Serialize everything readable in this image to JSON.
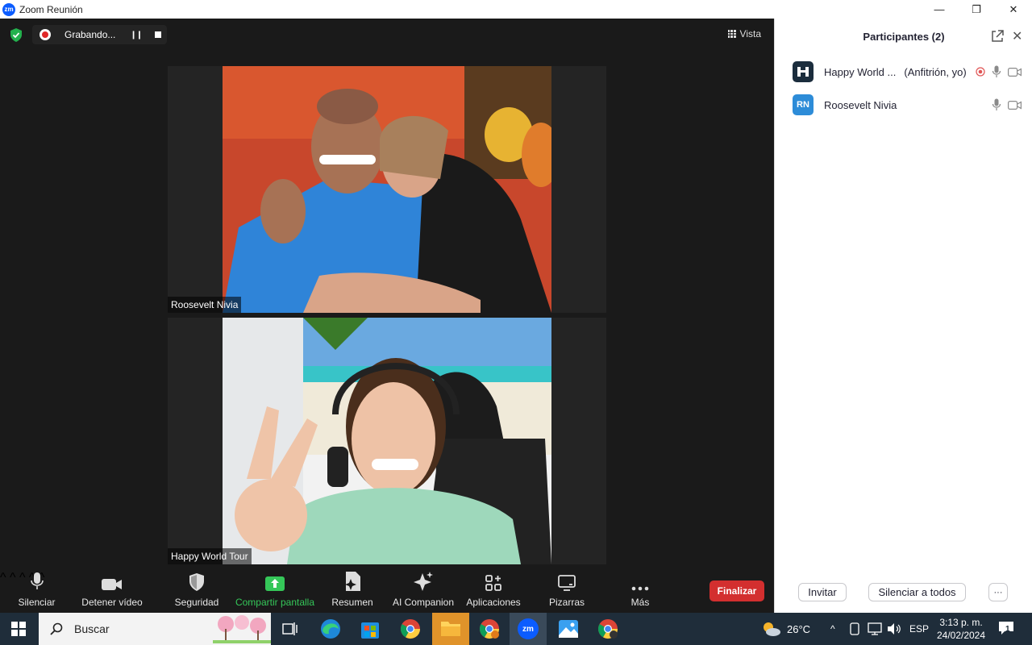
{
  "window": {
    "app_badge": "zm",
    "title": "Zoom Reunión",
    "controls": [
      "—",
      "❐",
      "✕"
    ]
  },
  "meeting": {
    "recording_label": "Grabando...",
    "view_label": "Vista",
    "tiles": [
      {
        "name": "Roosevelt Nivia"
      },
      {
        "name": "Happy World Tour"
      }
    ]
  },
  "toolbar": {
    "items": [
      {
        "label": "Silenciar",
        "icon": "microphone-icon"
      },
      {
        "label": "Detener vídeo",
        "icon": "video-camera-icon"
      },
      {
        "label": "Seguridad",
        "icon": "shield-icon"
      },
      {
        "label": "Compartir pantalla",
        "icon": "share-screen-icon"
      },
      {
        "label": "Resumen",
        "icon": "summary-icon"
      },
      {
        "label": "AI Companion",
        "icon": "sparkle-icon"
      },
      {
        "label": "Aplicaciones",
        "icon": "apps-icon"
      },
      {
        "label": "Pizarras",
        "icon": "whiteboard-icon"
      },
      {
        "label": "Más",
        "icon": "more-icon"
      }
    ],
    "end_label": "Finalizar",
    "colors": {
      "end": "#d32f2f",
      "share": "#35c759"
    }
  },
  "participants": {
    "title": "Participantes (2)",
    "list": [
      {
        "name": "Happy World ...",
        "role": "(Anfitrión, yo)",
        "avatar": "logo"
      },
      {
        "name": "Roosevelt Nivia",
        "role": "",
        "avatar": "RN"
      }
    ],
    "invite_label": "Invitar",
    "mute_all_label": "Silenciar a todos",
    "more_label": "···"
  },
  "taskbar": {
    "search_placeholder": "Buscar",
    "temperature": "26°C",
    "language": "ESP",
    "time": "3:13 p. m.",
    "date": "24/02/2024",
    "notifications": "1"
  }
}
